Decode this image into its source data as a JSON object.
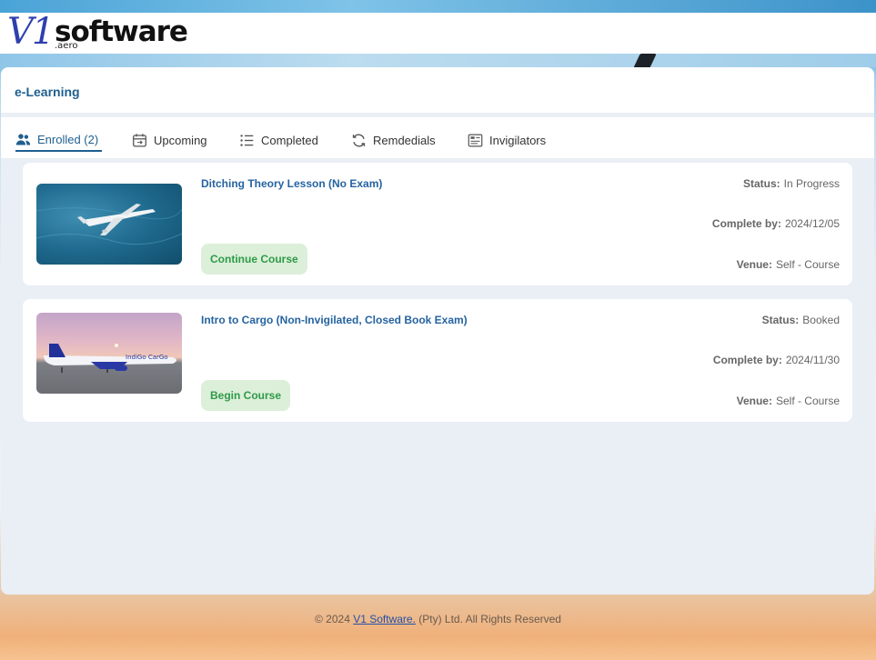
{
  "brand": {
    "logo_v1": "V1",
    "logo_software": "software",
    "logo_aero": ".aero"
  },
  "page": {
    "title": "e-Learning"
  },
  "tabs": [
    {
      "label": "Enrolled (2)",
      "icon": "users-icon",
      "active": true
    },
    {
      "label": "Upcoming",
      "icon": "calendar-icon",
      "active": false
    },
    {
      "label": "Completed",
      "icon": "list-icon",
      "active": false
    },
    {
      "label": "Remdedials",
      "icon": "refresh-icon",
      "active": false
    },
    {
      "label": "Invigilators",
      "icon": "id-card-icon",
      "active": false
    }
  ],
  "courses": [
    {
      "title": "Ditching Theory Lesson (No Exam)",
      "button": "Continue Course",
      "status_label": "Status:",
      "status": "In Progress",
      "complete_label": "Complete by:",
      "complete_by": "2024/12/05",
      "venue_label": "Venue:",
      "venue": "Self - Course"
    },
    {
      "title": "Intro to Cargo (Non-Invigilated, Closed Book Exam)",
      "button": "Begin Course",
      "status_label": "Status:",
      "status": "Booked",
      "complete_label": "Complete by:",
      "complete_by": "2024/11/30",
      "venue_label": "Venue:",
      "venue": "Self - Course",
      "thumbnail_text": "IndiGo CarGo"
    }
  ],
  "footer": {
    "prefix": "© 2024 ",
    "link": "V1 Software.",
    "suffix": " (Pty) Ltd. All Rights Reserved"
  },
  "colors": {
    "accent": "#1f5f8f",
    "link": "#2563a0",
    "button_bg": "#dcefd9",
    "button_text": "#2e9a48"
  }
}
